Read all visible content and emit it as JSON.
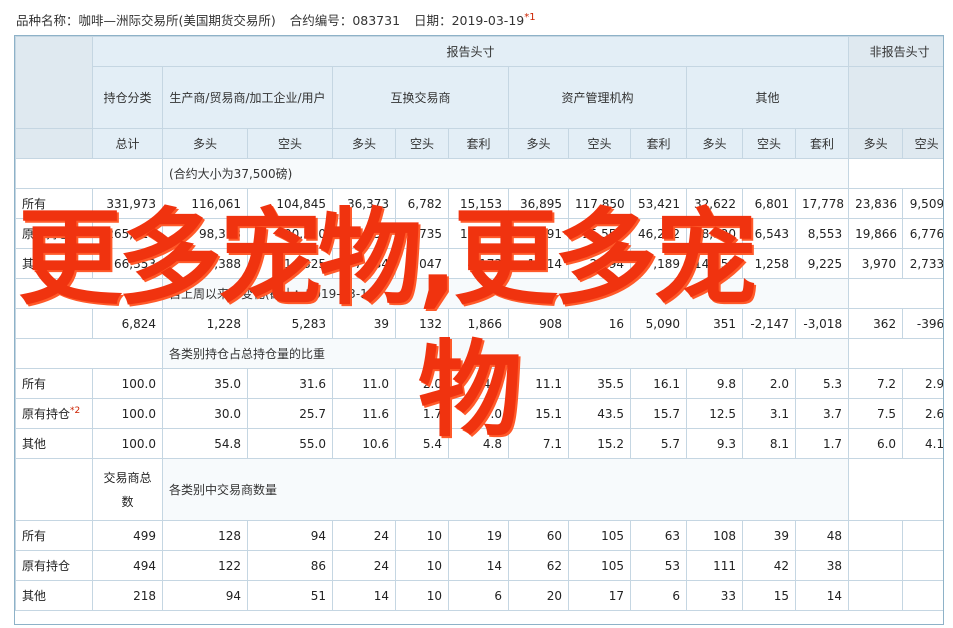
{
  "header": {
    "label_name": "品种名称",
    "name": "咖啡—洲际交易所(美国期货交易所)",
    "label_code": "合约编号",
    "code": "083731",
    "label_date": "日期",
    "date": "2019-03-19",
    "note_mark": "*1"
  },
  "table": {
    "reporting": "报告头寸",
    "nonreporting": "非报告头寸",
    "holding_class": "持仓分类",
    "groups": [
      "生产商/贸易商/加工企业/用户",
      "互换交易商",
      "资产管理机构",
      "其他"
    ],
    "col_total": "总计",
    "long": "多头",
    "short": "空头",
    "spread": "套利",
    "sec1_note": "(合约大小为37,500磅)",
    "rows1": [
      {
        "label": "所有",
        "values": [
          "331,973",
          "116,061",
          "104,845",
          "36,373",
          "6,782",
          "15,153",
          "36,895",
          "117,850",
          "53,421",
          "32,622",
          "6,801",
          "17,778",
          "23,836",
          "9,509"
        ]
      },
      {
        "label": "原有持仓",
        "values": [
          "265,620",
          "98,373",
          "90,520",
          "34,350",
          "6,735",
          "10,619",
          "40,091",
          "15,556",
          "46,232",
          "18,520",
          "6,543",
          "8,553",
          "19,866",
          "6,776"
        ]
      },
      {
        "label": "其他",
        "values": [
          "66,353",
          "17,388",
          "14,325",
          "7,034",
          "5,047",
          "4,173",
          "1,114",
          "2,294",
          "7,189",
          "14,159",
          "1,258",
          "9,225",
          "3,970",
          "2,733"
        ]
      }
    ],
    "change_note": "自上周以来的变化(截止：2019-03-12",
    "change_values": [
      "6,824",
      "1,228",
      "5,283",
      "39",
      "132",
      "1,866",
      "908",
      "16",
      "5,090",
      "351",
      "-2,147",
      "-3,018",
      "362",
      "-396"
    ],
    "pct_note": "各类别持仓占总持仓量的比重",
    "rows2": [
      {
        "label": "所有",
        "values": [
          "100.0",
          "35.0",
          "31.6",
          "11.0",
          "2.0",
          "4.6",
          "11.1",
          "35.5",
          "16.1",
          "9.8",
          "2.0",
          "5.3",
          "7.2",
          "2.9"
        ]
      },
      {
        "label": "原有持仓",
        "mark": "*2",
        "values": [
          "100.0",
          "30.0",
          "25.7",
          "11.6",
          "1.7",
          "4.0",
          "15.1",
          "43.5",
          "15.7",
          "12.5",
          "3.1",
          "3.7",
          "7.5",
          "2.6"
        ]
      },
      {
        "label": "其他",
        "values": [
          "100.0",
          "54.8",
          "55.0",
          "10.6",
          "5.4",
          "4.8",
          "7.1",
          "15.2",
          "5.7",
          "9.3",
          "8.1",
          "1.7",
          "6.0",
          "4.1"
        ]
      }
    ],
    "traders_total": "交易商总数",
    "traders_note": "各类别中交易商数量",
    "rows3": [
      {
        "label": "所有",
        "values": [
          "499",
          "128",
          "94",
          "24",
          "10",
          "19",
          "60",
          "105",
          "63",
          "108",
          "39",
          "48"
        ]
      },
      {
        "label": "原有持仓",
        "values": [
          "494",
          "122",
          "86",
          "24",
          "10",
          "14",
          "62",
          "105",
          "53",
          "111",
          "42",
          "38"
        ]
      },
      {
        "label": "其他",
        "values": [
          "218",
          "94",
          "51",
          "14",
          "10",
          "6",
          "20",
          "17",
          "6",
          "33",
          "15",
          "14"
        ]
      }
    ]
  },
  "overlay": {
    "line1": "更多宠物,更多宠",
    "line2": "物"
  }
}
